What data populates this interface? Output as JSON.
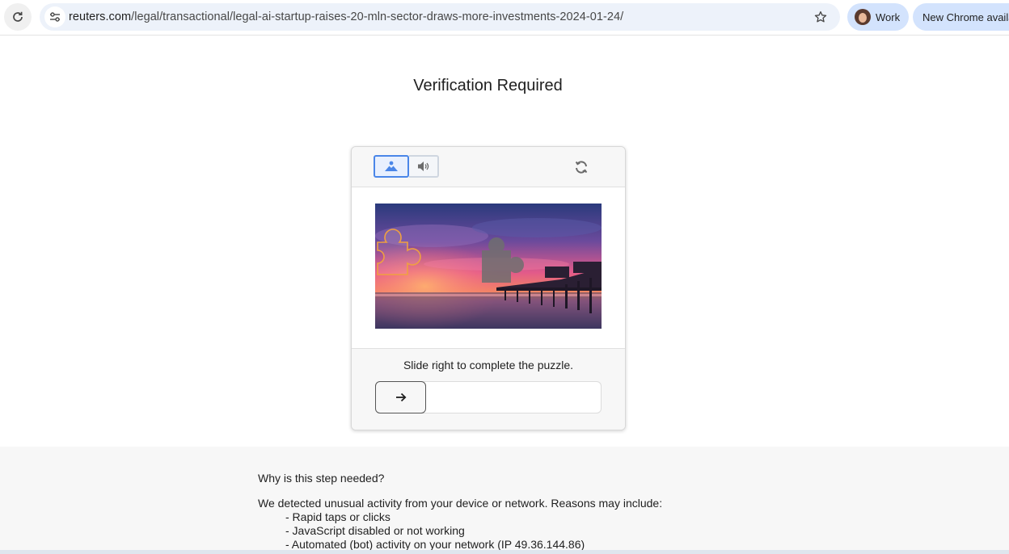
{
  "browser": {
    "url_domain": "reuters.com",
    "url_path": "/legal/transactional/legal-ai-startup-raises-20-mln-sector-draws-more-investments-2024-01-24/",
    "profile_label": "Work",
    "update_label": "New Chrome available"
  },
  "page": {
    "title": "Verification Required"
  },
  "captcha": {
    "instruction": "Slide right to complete the puzzle.",
    "icons": {
      "image_mode": "image-icon",
      "audio_mode": "speaker-icon",
      "refresh": "refresh-icon",
      "slider": "arrow-right-icon"
    },
    "accent_color": "#4a86e8"
  },
  "info": {
    "question": "Why is this step needed?",
    "reason_intro": "We detected unusual activity from your device or network. Reasons may include:",
    "reasons": [
      "- Rapid taps or clicks",
      "- JavaScript disabled or not working",
      "- Automated (bot) activity on your network (IP 49.36.144.86)"
    ]
  }
}
